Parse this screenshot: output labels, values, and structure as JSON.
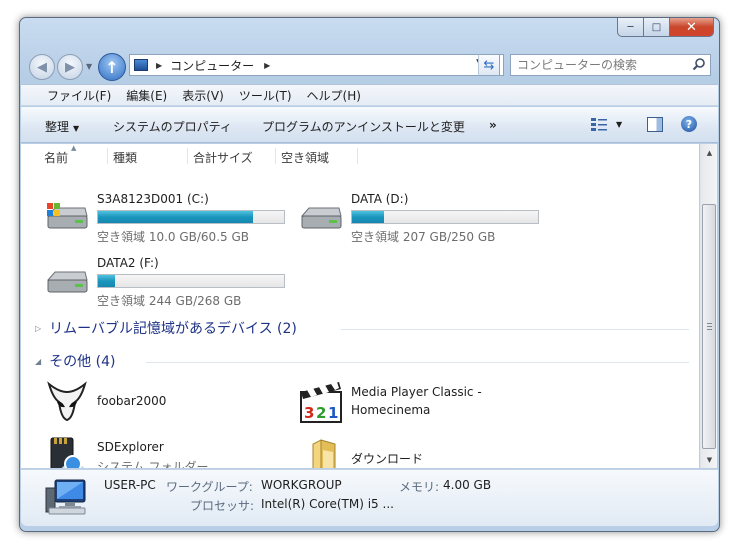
{
  "window": {
    "caption": {
      "minimize": "─",
      "maximize": "□",
      "close": "✕"
    }
  },
  "address": {
    "path_label": "コンピューター"
  },
  "search": {
    "placeholder": "コンピューターの検索"
  },
  "menu": [
    "ファイル(F)",
    "編集(E)",
    "表示(V)",
    "ツール(T)",
    "ヘルプ(H)"
  ],
  "toolbar": {
    "organize": "整理",
    "system_properties": "システムのプロパティ",
    "uninstall": "プログラムのアンインストールと変更",
    "more": "»"
  },
  "columns": [
    "名前",
    "種類",
    "合計サイズ",
    "空き領域"
  ],
  "drives": [
    {
      "name": "S3A8123D001 (C:)",
      "free_text": "空き領域 10.0 GB/60.5 GB",
      "used_fraction": 0.835
    },
    {
      "name": "DATA (D:)",
      "free_text": "空き領域 207 GB/250 GB",
      "used_fraction": 0.172
    },
    {
      "name": "DATA2 (F:)",
      "free_text": "空き領域 244 GB/268 GB",
      "used_fraction": 0.09
    }
  ],
  "groups": {
    "removable": "リムーバブル記憶域があるデバイス (2)",
    "other": "その他 (4)"
  },
  "other_items": [
    {
      "label": "foobar2000",
      "sub": ""
    },
    {
      "label": "Media Player Classic -",
      "label2": "Homecinema"
    },
    {
      "label": "SDExplorer",
      "sub": "システム フォルダー"
    },
    {
      "label": "ダウンロード",
      "sub": ""
    }
  ],
  "details": {
    "name": "USER-PC",
    "workgroup_label": "ワークグループ:",
    "workgroup_value": "WORKGROUP",
    "memory_label": "メモリ:",
    "memory_value": "4.00 GB",
    "processor_label": "プロセッサ:",
    "processor_value": "Intel(R) Core(TM) i5 ..."
  },
  "colors": {
    "drive_fill": "#1b95bd",
    "group_header": "#1e3287",
    "secondary_text": "#6d6d6d"
  }
}
